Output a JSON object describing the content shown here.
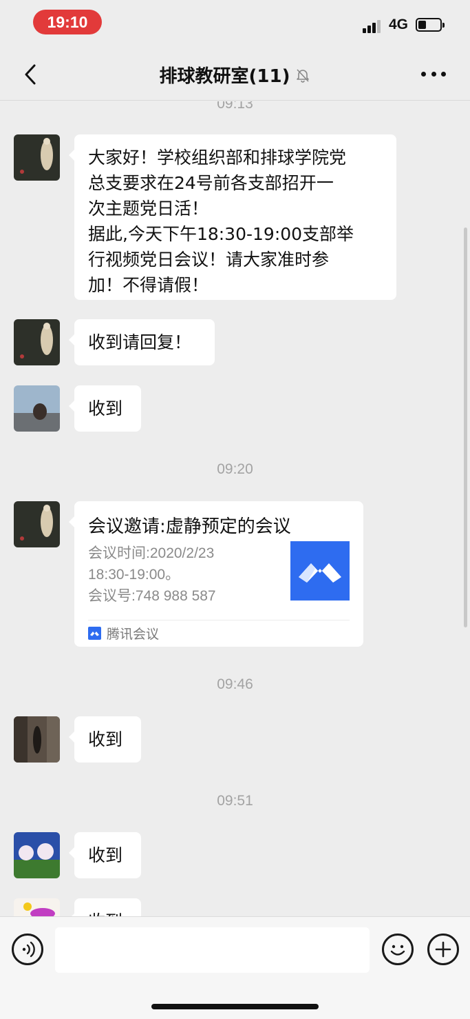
{
  "status_bar": {
    "time": "19:10",
    "network": "4G"
  },
  "nav": {
    "title": "排球教研室(11)"
  },
  "chat": {
    "timestamps": [
      "09:13",
      "09:20",
      "09:46",
      "09:51"
    ],
    "messages": [
      {
        "text_lines": [
          "大家好！学校组织部和排球学院党",
          "总支要求在24号前各支部招开一",
          "次主题党日活！",
          "据此,今天下午18:30-19:00支部举",
          "行视频党日会议！请大家准时参",
          "加！不得请假！"
        ]
      },
      {
        "text": "收到请回复！"
      },
      {
        "text": "收到"
      },
      {
        "text": "收到"
      },
      {
        "text": "收到"
      },
      {
        "text": "收到"
      }
    ],
    "card": {
      "title": "会议邀请:虚静预定的会议",
      "desc_lines": [
        "会议时间:2020/2/23",
        "18:30-19:00。",
        "会议号:748 988 587"
      ],
      "source": "腾讯会议"
    }
  },
  "icons": {
    "back": "chevron-left-icon",
    "mute": "bell-muted-icon",
    "more": "more-dots-icon",
    "voice": "voice-icon",
    "emoji": "emoji-icon",
    "plus": "plus-icon"
  },
  "colors": {
    "time_pill": "#e23a3a",
    "tencent_blue": "#2e6cf0",
    "background": "#ededed"
  }
}
